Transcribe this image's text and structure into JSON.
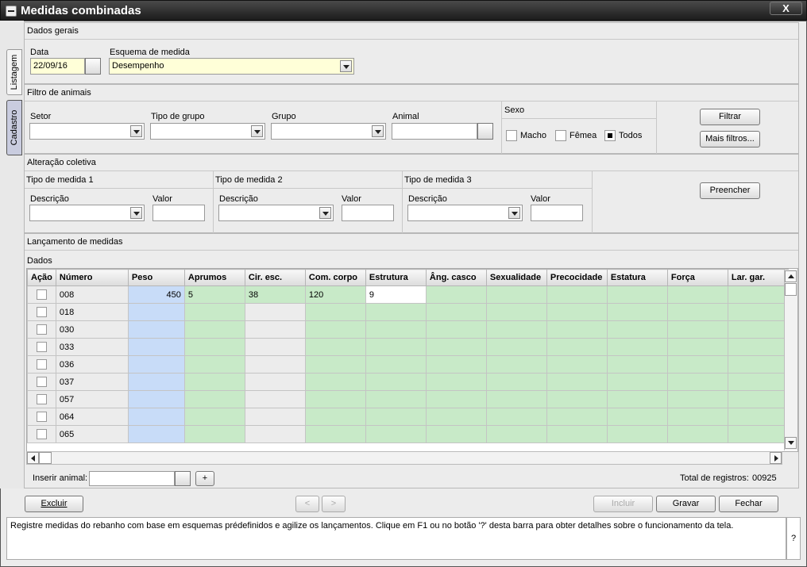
{
  "window": {
    "title": "Medidas combinadas",
    "close_label": "X"
  },
  "side_tabs": {
    "listagem": "Listagem",
    "cadastro": "Cadastro"
  },
  "dados_gerais": {
    "header": "Dados gerais",
    "data_label": "Data",
    "data_value": "22/09/16",
    "esquema_label": "Esquema de medida",
    "esquema_value": "Desempenho"
  },
  "filtro": {
    "header": "Filtro de animais",
    "setor_label": "Setor",
    "tipo_grupo_label": "Tipo de grupo",
    "grupo_label": "Grupo",
    "animal_label": "Animal",
    "sexo_label": "Sexo",
    "sexo_options": [
      "Macho",
      "Fêmea",
      "Todos"
    ],
    "sexo_selected": "Todos",
    "filtrar_label": "Filtrar",
    "mais_filtros_label": "Mais filtros..."
  },
  "alteracao": {
    "header": "Alteração coletiva",
    "tipo1": "Tipo de medida 1",
    "tipo2": "Tipo de medida 2",
    "tipo3": "Tipo de medida 3",
    "descricao_label": "Descrição",
    "valor_label": "Valor",
    "preencher_label": "Preencher"
  },
  "lancamento": {
    "header": "Lançamento de medidas",
    "dados_label": "Dados",
    "columns": [
      "Ação",
      "Número",
      "Peso",
      "Aprumos",
      "Cir. esc.",
      "Com. corpo",
      "Estrutura",
      "Âng. casco",
      "Sexualidade",
      "Precocidade",
      "Estatura",
      "Força",
      "Lar. gar."
    ],
    "rows": [
      {
        "numero": "008",
        "peso": "450",
        "aprumos": "5",
        "cir": "38",
        "com": "120",
        "estrutura": "9"
      },
      {
        "numero": "018",
        "peso": "",
        "aprumos": "",
        "cir": "",
        "com": "",
        "estrutura": ""
      },
      {
        "numero": "030",
        "peso": "",
        "aprumos": "",
        "cir": "",
        "com": "",
        "estrutura": ""
      },
      {
        "numero": "033",
        "peso": "",
        "aprumos": "",
        "cir": "",
        "com": "",
        "estrutura": ""
      },
      {
        "numero": "036",
        "peso": "",
        "aprumos": "",
        "cir": "",
        "com": "",
        "estrutura": ""
      },
      {
        "numero": "037",
        "peso": "",
        "aprumos": "",
        "cir": "",
        "com": "",
        "estrutura": ""
      },
      {
        "numero": "057",
        "peso": "",
        "aprumos": "",
        "cir": "",
        "com": "",
        "estrutura": ""
      },
      {
        "numero": "064",
        "peso": "",
        "aprumos": "",
        "cir": "",
        "com": "",
        "estrutura": ""
      },
      {
        "numero": "065",
        "peso": "",
        "aprumos": "",
        "cir": "",
        "com": "",
        "estrutura": ""
      }
    ],
    "inserir_label": "Inserir animal:",
    "add_label": "+",
    "total_label": "Total de registros:",
    "total_value": "00925"
  },
  "footer": {
    "excluir": "Excluir",
    "prev": "<",
    "next": ">",
    "incluir": "Incluir",
    "gravar": "Gravar",
    "fechar": "Fechar"
  },
  "help": {
    "text": "Registre medidas do rebanho com base em esquemas prédefinidos e agilize os lançamentos. Clique em F1 ou no botão '?' desta barra para obter detalhes sobre o funcionamento da tela.",
    "q": "?"
  },
  "colors": {
    "peso_col": "#c8dcf8",
    "green_col": "#c8eac8",
    "esquema_bg": "#ffffd8",
    "data_bg": "#ffffd8"
  }
}
